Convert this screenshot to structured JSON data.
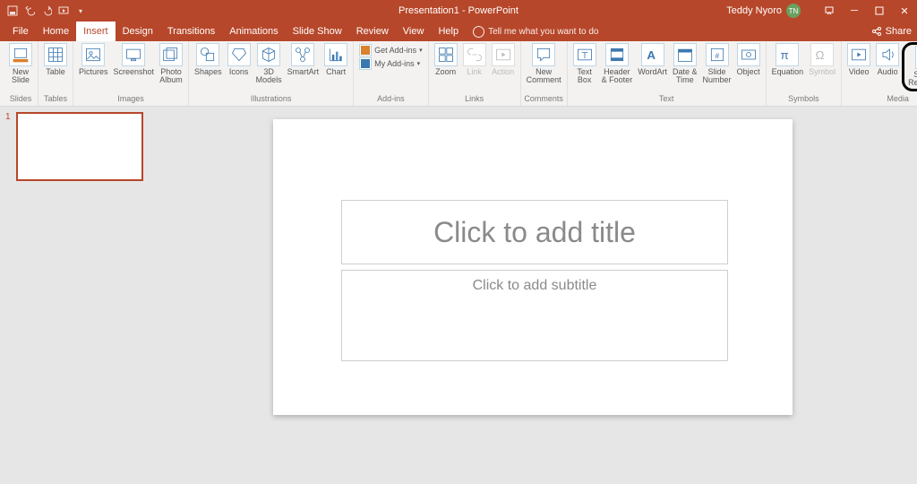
{
  "titlebar": {
    "title": "Presentation1 - PowerPoint",
    "user_name": "Teddy Nyoro",
    "user_initials": "TN"
  },
  "tabs": {
    "items": [
      "File",
      "Home",
      "Insert",
      "Design",
      "Transitions",
      "Animations",
      "Slide Show",
      "Review",
      "View",
      "Help"
    ],
    "active": "Insert",
    "tell_me": "Tell me what you want to do",
    "share": "Share"
  },
  "ribbon": {
    "groups": [
      {
        "name": "Slides",
        "buttons": [
          {
            "label": "New\nSlide",
            "icon": "new-slide"
          }
        ]
      },
      {
        "name": "Tables",
        "buttons": [
          {
            "label": "Table",
            "icon": "table"
          }
        ]
      },
      {
        "name": "Images",
        "buttons": [
          {
            "label": "Pictures",
            "icon": "pictures"
          },
          {
            "label": "Screenshot",
            "icon": "screenshot"
          },
          {
            "label": "Photo\nAlbum",
            "icon": "album"
          }
        ]
      },
      {
        "name": "Illustrations",
        "buttons": [
          {
            "label": "Shapes",
            "icon": "shapes"
          },
          {
            "label": "Icons",
            "icon": "icons"
          },
          {
            "label": "3D\nModels",
            "icon": "3d"
          },
          {
            "label": "SmartArt",
            "icon": "smartart"
          },
          {
            "label": "Chart",
            "icon": "chart"
          }
        ]
      },
      {
        "name": "Add-ins",
        "mini": [
          {
            "label": "Get Add-ins",
            "icon": "get-addins"
          },
          {
            "label": "My Add-ins",
            "icon": "my-addins"
          }
        ]
      },
      {
        "name": "Links",
        "buttons": [
          {
            "label": "Zoom",
            "icon": "zoom"
          },
          {
            "label": "Link",
            "icon": "link",
            "disabled": true
          },
          {
            "label": "Action",
            "icon": "action",
            "disabled": true
          }
        ]
      },
      {
        "name": "Comments",
        "buttons": [
          {
            "label": "New\nComment",
            "icon": "comment"
          }
        ]
      },
      {
        "name": "Text",
        "buttons": [
          {
            "label": "Text\nBox",
            "icon": "textbox"
          },
          {
            "label": "Header\n& Footer",
            "icon": "headerfooter"
          },
          {
            "label": "WordArt",
            "icon": "wordart"
          },
          {
            "label": "Date &\nTime",
            "icon": "datetime"
          },
          {
            "label": "Slide\nNumber",
            "icon": "slidenum"
          },
          {
            "label": "Object",
            "icon": "object"
          }
        ]
      },
      {
        "name": "Symbols",
        "buttons": [
          {
            "label": "Equation",
            "icon": "equation"
          },
          {
            "label": "Symbol",
            "icon": "symbol",
            "disabled": true
          }
        ]
      },
      {
        "name": "Media",
        "buttons": [
          {
            "label": "Video",
            "icon": "video"
          },
          {
            "label": "Audio",
            "icon": "audio"
          },
          {
            "label": "Screen\nRecording",
            "icon": "screenrec",
            "highlight": true
          }
        ]
      }
    ]
  },
  "slide": {
    "number": "1",
    "title_placeholder": "Click to add title",
    "subtitle_placeholder": "Click to add subtitle"
  }
}
